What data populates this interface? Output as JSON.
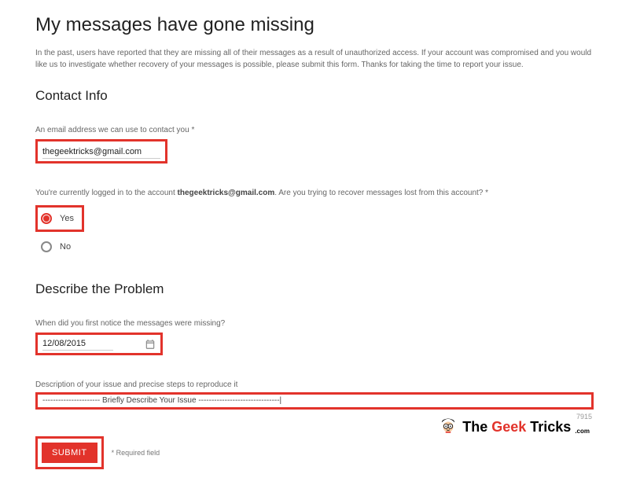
{
  "title": "My messages have gone missing",
  "intro": "In the past, users have reported that they are missing all of their messages as a result of unauthorized access. If your account was compromised and you would like us to investigate whether recovery of your messages is possible, please submit this form. Thanks for taking the time to report your issue.",
  "contact": {
    "heading": "Contact Info",
    "email_label": "An email address we can use to contact you *",
    "email_value": "thegeektricks@gmail.com",
    "logged_in_prefix": "You're currently logged in to the account ",
    "logged_in_account": "thegeektricks@gmail.com",
    "logged_in_suffix": ". Are you trying to recover messages lost from this account? *",
    "yes_label": "Yes",
    "no_label": "No"
  },
  "problem": {
    "heading": "Describe the Problem",
    "when_label": "When did you first notice the messages were missing?",
    "when_value": "12/08/2015",
    "desc_label": "Description of your issue and precise steps to reproduce it",
    "desc_value": "---------------------- Briefly Describe Your Issue -------------------------------|",
    "char_count": "7915"
  },
  "submit": {
    "label": "SUBMIT",
    "required_note": "* Required field"
  },
  "logo": {
    "part1": "The",
    "part2": "Geek",
    "part3": "Tricks",
    "suffix": ".com"
  }
}
